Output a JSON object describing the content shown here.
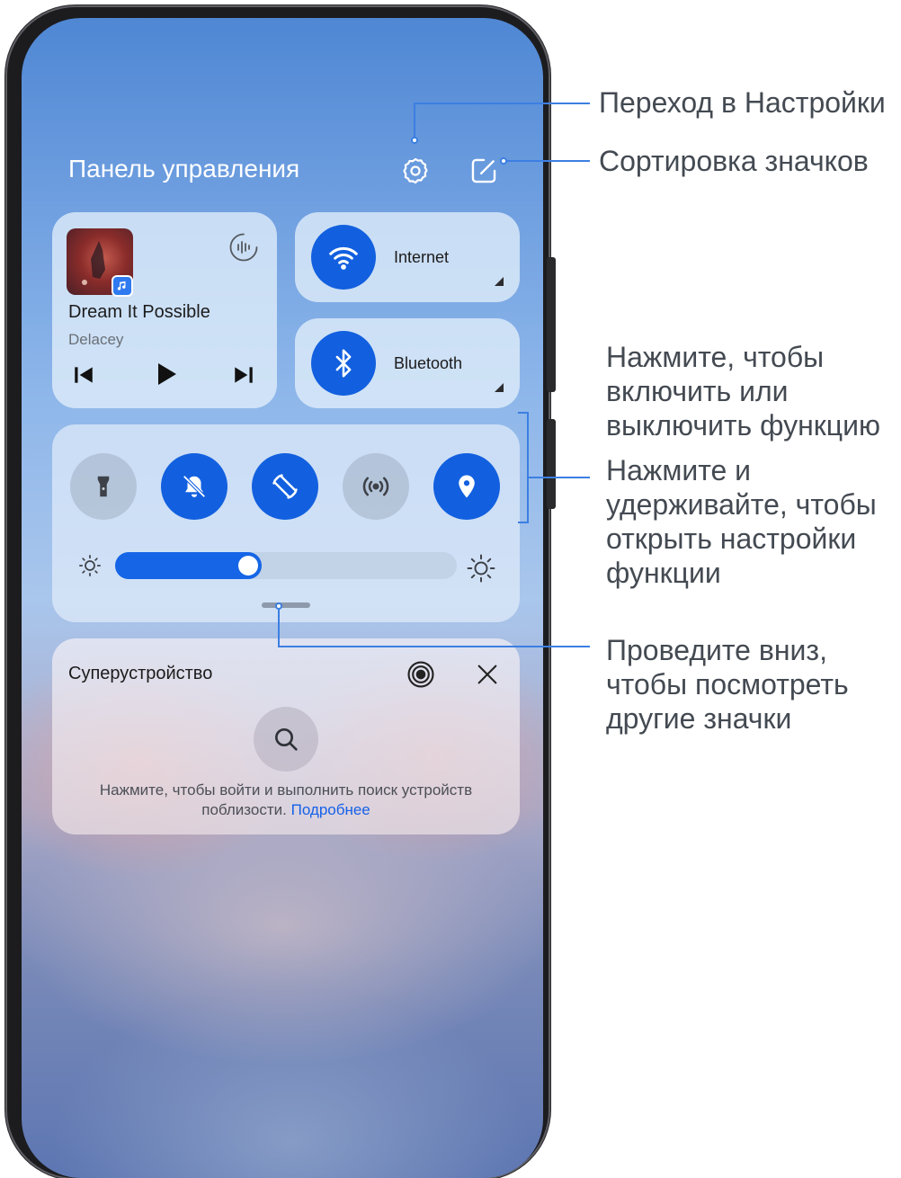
{
  "panel": {
    "title": "Панель управления",
    "settings_icon": "gear-icon",
    "edit_icon": "edit-square-icon"
  },
  "music": {
    "title": "Dream It Possible",
    "artist": "Delacey",
    "album_icon": "album-art",
    "app_icon": "music-note-icon",
    "audio_output_icon": "audio-wave-icon",
    "controls": [
      "previous-track-icon",
      "play-icon",
      "next-track-icon"
    ]
  },
  "tiles": {
    "internet": {
      "label": "Internet",
      "icon": "wifi-icon",
      "active": true
    },
    "bluetooth": {
      "label": "Bluetooth",
      "icon": "bluetooth-icon",
      "active": true
    }
  },
  "quick_toggles": [
    {
      "name": "flashlight",
      "icon": "flashlight-icon",
      "on": false
    },
    {
      "name": "silent",
      "icon": "bell-off-icon",
      "on": true
    },
    {
      "name": "auto-rotate",
      "icon": "rotate-icon",
      "on": true
    },
    {
      "name": "hotspot",
      "icon": "hotspot-icon",
      "on": false
    },
    {
      "name": "location",
      "icon": "location-pin-icon",
      "on": true
    }
  ],
  "brightness": {
    "level_percent": 43
  },
  "super_device": {
    "title": "Суперустройство",
    "hint": "Нажмите, чтобы войти и выполнить поиск устройств поблизости.",
    "link": "Подробнее"
  },
  "annotations": {
    "settings": "Переход в Настройки",
    "sort_icons": "Сортировка значков",
    "tap_toggle": "Нажмите, чтобы\nвключить или\nвыключить функцию",
    "hold_settings": "Нажмите и\nудерживайте, чтобы\nоткрыть настройки\nфункции",
    "swipe_down": "Проведите вниз,\nчтобы посмотреть\nдругие значки"
  },
  "colors": {
    "accent": "#1260df",
    "annotation_line": "#3c7fe2",
    "link": "#1560e8"
  }
}
